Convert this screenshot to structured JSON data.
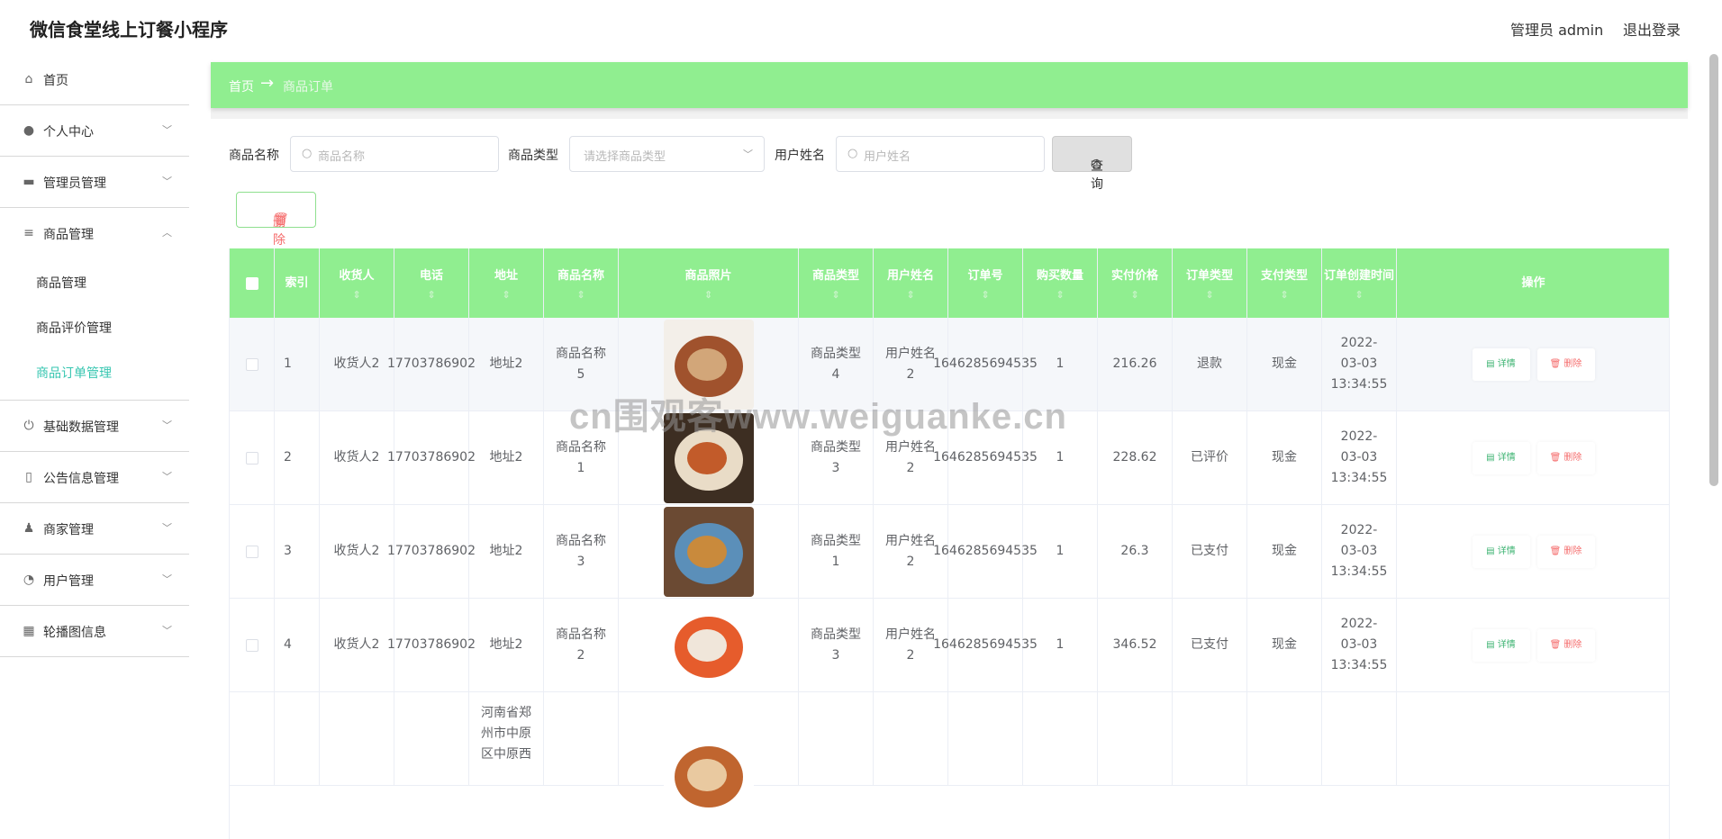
{
  "app": {
    "title": "微信食堂线上订餐小程序",
    "admin_label": "管理员 admin",
    "logout_label": "退出登录"
  },
  "sidebar": {
    "items": [
      {
        "label": "首页",
        "icon": "home-icon"
      },
      {
        "label": "个人中心",
        "icon": "user-icon"
      },
      {
        "label": "管理员管理",
        "icon": "briefcase-icon"
      },
      {
        "label": "商品管理",
        "icon": "list-icon"
      },
      {
        "label": "基础数据管理",
        "icon": "power-icon"
      },
      {
        "label": "公告信息管理",
        "icon": "phone-icon"
      },
      {
        "label": "商家管理",
        "icon": "person-icon"
      },
      {
        "label": "用户管理",
        "icon": "gauge-icon"
      },
      {
        "label": "轮播图信息",
        "icon": "grid-icon"
      }
    ],
    "submenu": [
      "商品管理",
      "商品评价管理",
      "商品订单管理"
    ]
  },
  "breadcrumb": {
    "home": "首页",
    "arrow": "→",
    "current": "商品订单"
  },
  "search": {
    "name_label": "商品名称",
    "name_placeholder": "商品名称",
    "type_label": "商品类型",
    "type_placeholder": "请选择商品类型",
    "user_label": "用户姓名",
    "user_placeholder": "用户姓名",
    "query_label": "查询",
    "delete_label": "删除"
  },
  "table": {
    "headers": [
      "索引",
      "收货人",
      "电话",
      "地址",
      "商品名称",
      "商品照片",
      "商品类型",
      "用户姓名",
      "订单号",
      "购买数量",
      "实付价格",
      "订单类型",
      "支付类型",
      "订单创建时间",
      "操作"
    ],
    "rows": [
      {
        "index": "1",
        "receiver": "收货人2",
        "phone": "17703786902",
        "address": "地址2",
        "name": "商品名称5",
        "type": "商品类型4",
        "user": "用户姓名2",
        "order_no": "1646285694535",
        "qty": "1",
        "price": "216.26",
        "order_type": "退款",
        "pay_type": "现金",
        "created": "2022-03-03 13:34:55"
      },
      {
        "index": "2",
        "receiver": "收货人2",
        "phone": "17703786902",
        "address": "地址2",
        "name": "商品名称1",
        "type": "商品类型3",
        "user": "用户姓名2",
        "order_no": "1646285694535",
        "qty": "1",
        "price": "228.62",
        "order_type": "已评价",
        "pay_type": "现金",
        "created": "2022-03-03 13:34:55"
      },
      {
        "index": "3",
        "receiver": "收货人2",
        "phone": "17703786902",
        "address": "地址2",
        "name": "商品名称3",
        "type": "商品类型1",
        "user": "用户姓名2",
        "order_no": "1646285694535",
        "qty": "1",
        "price": "26.3",
        "order_type": "已支付",
        "pay_type": "现金",
        "created": "2022-03-03 13:34:55"
      },
      {
        "index": "4",
        "receiver": "收货人2",
        "phone": "17703786902",
        "address": "地址2",
        "name": "商品名称2",
        "type": "商品类型3",
        "user": "用户姓名2",
        "order_no": "1646285694535",
        "qty": "1",
        "price": "346.52",
        "order_type": "已支付",
        "pay_type": "现金",
        "created": "2022-03-03 13:34:55"
      },
      {
        "index": "",
        "receiver": "",
        "phone": "",
        "address": "河南省郑州市中原区中原西",
        "name": "",
        "type": "",
        "user": "",
        "order_no": "",
        "qty": "",
        "price": "",
        "order_type": "",
        "pay_type": "",
        "created": ""
      }
    ],
    "detail_label": "详情",
    "delete_label": "删除"
  },
  "watermark": "cn围观客www.weiguanke.cn"
}
